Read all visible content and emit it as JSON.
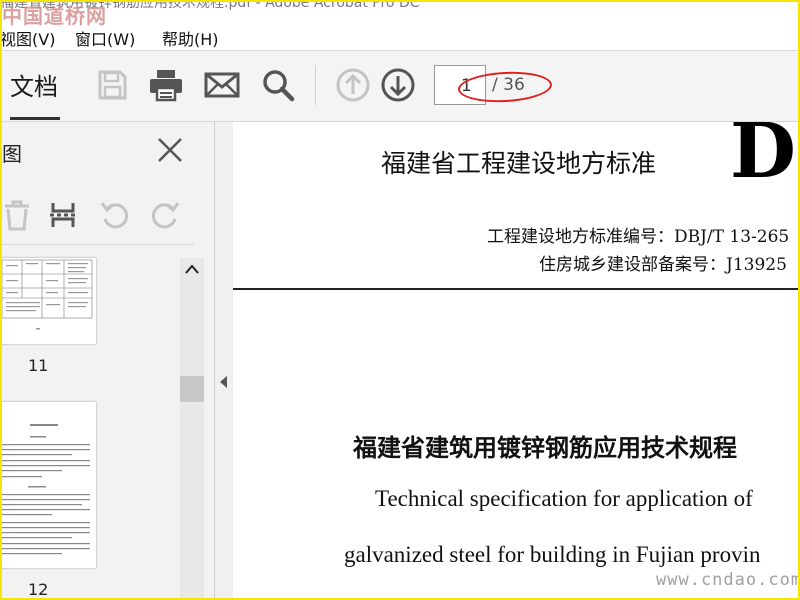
{
  "window": {
    "title": "福建省建筑用镀锌钢筋应用技术规程.pdf - Adobe Acrobat Pro DC"
  },
  "watermarks": {
    "top": "中国道桥网",
    "bottom": "www.cndao.com"
  },
  "menu": {
    "items": [
      "视图(V)",
      "窗口(W)",
      "帮助(H)"
    ]
  },
  "toolbar": {
    "tab_label": "文档",
    "page_current": "1",
    "page_total": "/ 36",
    "icons": [
      "save-icon",
      "print-icon",
      "mail-icon",
      "search-icon",
      "prev-page-icon",
      "next-page-icon"
    ]
  },
  "sidebar": {
    "title": "图",
    "tools": [
      "delete-icon",
      "extract-icon",
      "rotate-left-icon",
      "rotate-right-icon"
    ],
    "thumbnails": [
      {
        "page": "11"
      },
      {
        "page": "12"
      }
    ]
  },
  "document": {
    "header": "福建省工程建设地方标准",
    "big_code": "DB",
    "standard_no": "工程建设地方标准编号：DBJ/T 13-265",
    "record_no": "住房城乡建设部备案号：J13925",
    "title_cn": "福建省建筑用镀锌钢筋应用技术规程",
    "title_en_1": "Technical specification for application of",
    "title_en_2": "galvanized steel for building in Fujian provin"
  },
  "colors": {
    "accent_red": "#e02020",
    "frame_yellow": "#f5e500"
  }
}
